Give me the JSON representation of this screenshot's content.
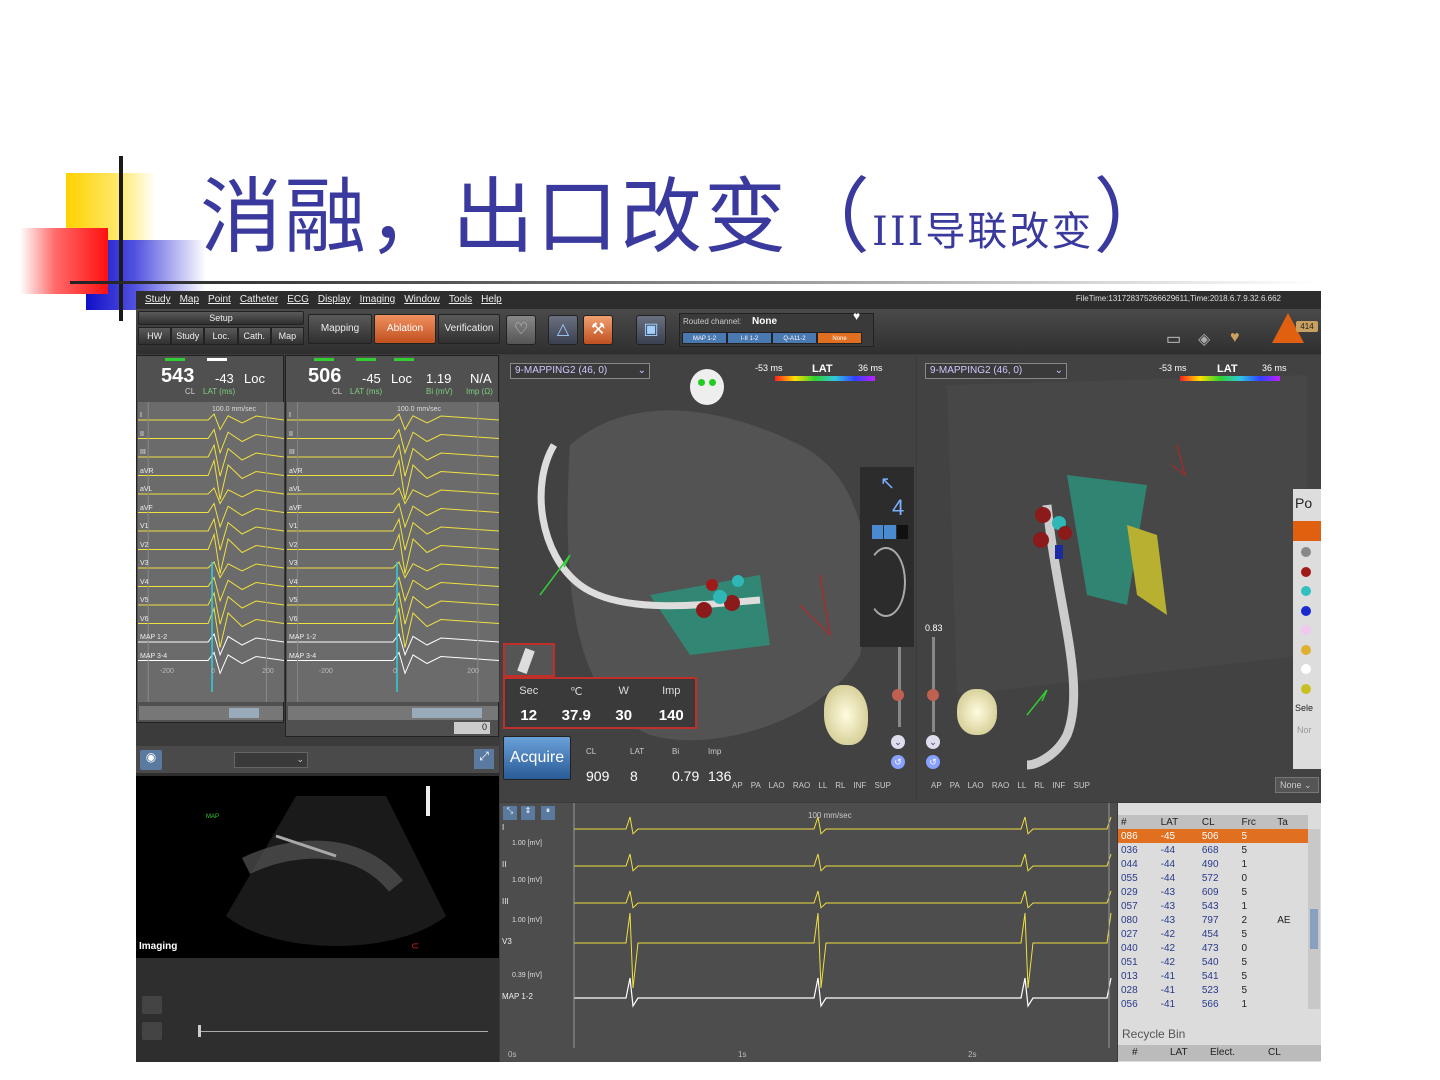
{
  "slide": {
    "title_main": "消融，出口改变（",
    "title_sub": "III导联改变",
    "title_end": "）"
  },
  "app": {
    "menu": [
      "Study",
      "Map",
      "Point",
      "Catheter",
      "ECG",
      "Display",
      "Imaging",
      "Window",
      "Tools",
      "Help"
    ],
    "file_time": "FileTime:131728375266629611,Time:2018.6.7.9.32.6.662",
    "toolbar": {
      "setup_label": "Setup",
      "setup_tabs": [
        "HW",
        "Study",
        "Loc.",
        "Cath.",
        "Map"
      ],
      "workflow": [
        "Mapping",
        "Ablation",
        "Verification"
      ],
      "routed_label": "Routed channel:",
      "routed_value": "None",
      "routed_tabs": [
        "MAP 1-2",
        "I-II 1-2",
        "Q-A11-2",
        "None"
      ],
      "badge": "414"
    },
    "ecg_left": {
      "cl": "543",
      "lat": "-43",
      "loc": "Loc",
      "cl_label": "CL",
      "lat_label": "LAT (ms)",
      "speed": "100.0 mm/sec",
      "ticks": [
        "-200",
        "0",
        "200"
      ]
    },
    "ecg_right": {
      "cl": "506",
      "lat": "-45",
      "loc": "Loc",
      "bi": "1.19",
      "imp": "N/A",
      "cl_label": "CL",
      "lat_label": "LAT (ms)",
      "bi_label": "Bi (mV)",
      "imp_label": "Imp (Ω)",
      "speed": "100.0 mm/sec",
      "ticks": [
        "-200",
        "0",
        "200"
      ],
      "scroll_value": "0"
    },
    "leads": [
      "I",
      "II",
      "III",
      "aVR",
      "aVL",
      "aVF",
      "V1",
      "V2",
      "V3",
      "V4",
      "V5",
      "V6",
      "MAP 1-2",
      "MAP 3-4"
    ],
    "map_left": {
      "selector": "9-MAPPING2 (46, 0)",
      "scale_min": "-53 ms",
      "scale_label": "LAT",
      "scale_max": "36 ms",
      "side_number": "4",
      "ablation": {
        "headers": [
          "Sec",
          "℃",
          "W",
          "Imp"
        ],
        "values": [
          "12",
          "37.9",
          "30",
          "140"
        ]
      },
      "acquire": "Acquire",
      "readout_headers": [
        "CL",
        "LAT",
        "Bi",
        "Imp"
      ],
      "readout_values": [
        "909",
        "8",
        "0.79",
        "136"
      ],
      "views": "AP PA LAO RAO LL RL INF SUP"
    },
    "map_right": {
      "selector": "9-MAPPING2 (46, 0)",
      "scale_min": "-53 ms",
      "scale_label": "LAT",
      "scale_max": "36 ms",
      "value": "0.83",
      "views": "AP PA LAO RAO LL RL INF SUP",
      "none_dd": "None",
      "side_title": "Po",
      "side_select": "Sele",
      "side_none": "Nor"
    },
    "imaging": {
      "label": "Imaging",
      "map_tag": "MAP"
    },
    "signals": {
      "speed": "100 mm/sec",
      "leads": [
        {
          "name": "I",
          "scale": ""
        },
        {
          "name": "II",
          "scale": "1.00 [mV]"
        },
        {
          "name": "III",
          "scale": "1.00 [mV]"
        },
        {
          "name": "V3",
          "scale": "1.00 [mV]"
        },
        {
          "name": "MAP 1-2",
          "scale": "0.39 [mV]"
        }
      ],
      "time_ticks": [
        "0s",
        "1s",
        "2s"
      ]
    },
    "points_table": {
      "headers": [
        "#",
        "LAT",
        "CL",
        "Frc",
        "Ta"
      ],
      "rows": [
        [
          "086",
          "-45",
          "506",
          "5",
          ""
        ],
        [
          "036",
          "-44",
          "668",
          "5",
          ""
        ],
        [
          "044",
          "-44",
          "490",
          "1",
          ""
        ],
        [
          "055",
          "-44",
          "572",
          "0",
          ""
        ],
        [
          "029",
          "-43",
          "609",
          "5",
          ""
        ],
        [
          "057",
          "-43",
          "543",
          "1",
          ""
        ],
        [
          "080",
          "-43",
          "797",
          "2",
          "AE"
        ],
        [
          "027",
          "-42",
          "454",
          "5",
          ""
        ],
        [
          "040",
          "-42",
          "473",
          "0",
          ""
        ],
        [
          "051",
          "-42",
          "540",
          "5",
          ""
        ],
        [
          "013",
          "-41",
          "541",
          "5",
          ""
        ],
        [
          "028",
          "-41",
          "523",
          "5",
          ""
        ],
        [
          "056",
          "-41",
          "566",
          "1",
          ""
        ]
      ],
      "recycle_label": "Recycle Bin",
      "recycle_headers": [
        "#",
        "LAT",
        "Elect.",
        "CL"
      ]
    }
  }
}
